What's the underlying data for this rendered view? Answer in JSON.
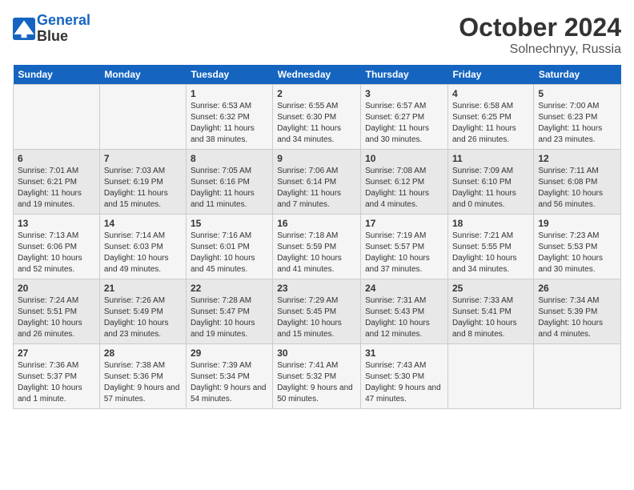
{
  "logo": {
    "line1": "General",
    "line2": "Blue"
  },
  "title": "October 2024",
  "subtitle": "Solnechnyy, Russia",
  "days_of_week": [
    "Sunday",
    "Monday",
    "Tuesday",
    "Wednesday",
    "Thursday",
    "Friday",
    "Saturday"
  ],
  "weeks": [
    [
      {
        "num": "",
        "info": ""
      },
      {
        "num": "",
        "info": ""
      },
      {
        "num": "1",
        "info": "Sunrise: 6:53 AM\nSunset: 6:32 PM\nDaylight: 11 hours and 38 minutes."
      },
      {
        "num": "2",
        "info": "Sunrise: 6:55 AM\nSunset: 6:30 PM\nDaylight: 11 hours and 34 minutes."
      },
      {
        "num": "3",
        "info": "Sunrise: 6:57 AM\nSunset: 6:27 PM\nDaylight: 11 hours and 30 minutes."
      },
      {
        "num": "4",
        "info": "Sunrise: 6:58 AM\nSunset: 6:25 PM\nDaylight: 11 hours and 26 minutes."
      },
      {
        "num": "5",
        "info": "Sunrise: 7:00 AM\nSunset: 6:23 PM\nDaylight: 11 hours and 23 minutes."
      }
    ],
    [
      {
        "num": "6",
        "info": "Sunrise: 7:01 AM\nSunset: 6:21 PM\nDaylight: 11 hours and 19 minutes."
      },
      {
        "num": "7",
        "info": "Sunrise: 7:03 AM\nSunset: 6:19 PM\nDaylight: 11 hours and 15 minutes."
      },
      {
        "num": "8",
        "info": "Sunrise: 7:05 AM\nSunset: 6:16 PM\nDaylight: 11 hours and 11 minutes."
      },
      {
        "num": "9",
        "info": "Sunrise: 7:06 AM\nSunset: 6:14 PM\nDaylight: 11 hours and 7 minutes."
      },
      {
        "num": "10",
        "info": "Sunrise: 7:08 AM\nSunset: 6:12 PM\nDaylight: 11 hours and 4 minutes."
      },
      {
        "num": "11",
        "info": "Sunrise: 7:09 AM\nSunset: 6:10 PM\nDaylight: 11 hours and 0 minutes."
      },
      {
        "num": "12",
        "info": "Sunrise: 7:11 AM\nSunset: 6:08 PM\nDaylight: 10 hours and 56 minutes."
      }
    ],
    [
      {
        "num": "13",
        "info": "Sunrise: 7:13 AM\nSunset: 6:06 PM\nDaylight: 10 hours and 52 minutes."
      },
      {
        "num": "14",
        "info": "Sunrise: 7:14 AM\nSunset: 6:03 PM\nDaylight: 10 hours and 49 minutes."
      },
      {
        "num": "15",
        "info": "Sunrise: 7:16 AM\nSunset: 6:01 PM\nDaylight: 10 hours and 45 minutes."
      },
      {
        "num": "16",
        "info": "Sunrise: 7:18 AM\nSunset: 5:59 PM\nDaylight: 10 hours and 41 minutes."
      },
      {
        "num": "17",
        "info": "Sunrise: 7:19 AM\nSunset: 5:57 PM\nDaylight: 10 hours and 37 minutes."
      },
      {
        "num": "18",
        "info": "Sunrise: 7:21 AM\nSunset: 5:55 PM\nDaylight: 10 hours and 34 minutes."
      },
      {
        "num": "19",
        "info": "Sunrise: 7:23 AM\nSunset: 5:53 PM\nDaylight: 10 hours and 30 minutes."
      }
    ],
    [
      {
        "num": "20",
        "info": "Sunrise: 7:24 AM\nSunset: 5:51 PM\nDaylight: 10 hours and 26 minutes."
      },
      {
        "num": "21",
        "info": "Sunrise: 7:26 AM\nSunset: 5:49 PM\nDaylight: 10 hours and 23 minutes."
      },
      {
        "num": "22",
        "info": "Sunrise: 7:28 AM\nSunset: 5:47 PM\nDaylight: 10 hours and 19 minutes."
      },
      {
        "num": "23",
        "info": "Sunrise: 7:29 AM\nSunset: 5:45 PM\nDaylight: 10 hours and 15 minutes."
      },
      {
        "num": "24",
        "info": "Sunrise: 7:31 AM\nSunset: 5:43 PM\nDaylight: 10 hours and 12 minutes."
      },
      {
        "num": "25",
        "info": "Sunrise: 7:33 AM\nSunset: 5:41 PM\nDaylight: 10 hours and 8 minutes."
      },
      {
        "num": "26",
        "info": "Sunrise: 7:34 AM\nSunset: 5:39 PM\nDaylight: 10 hours and 4 minutes."
      }
    ],
    [
      {
        "num": "27",
        "info": "Sunrise: 7:36 AM\nSunset: 5:37 PM\nDaylight: 10 hours and 1 minute."
      },
      {
        "num": "28",
        "info": "Sunrise: 7:38 AM\nSunset: 5:36 PM\nDaylight: 9 hours and 57 minutes."
      },
      {
        "num": "29",
        "info": "Sunrise: 7:39 AM\nSunset: 5:34 PM\nDaylight: 9 hours and 54 minutes."
      },
      {
        "num": "30",
        "info": "Sunrise: 7:41 AM\nSunset: 5:32 PM\nDaylight: 9 hours and 50 minutes."
      },
      {
        "num": "31",
        "info": "Sunrise: 7:43 AM\nSunset: 5:30 PM\nDaylight: 9 hours and 47 minutes."
      },
      {
        "num": "",
        "info": ""
      },
      {
        "num": "",
        "info": ""
      }
    ]
  ]
}
